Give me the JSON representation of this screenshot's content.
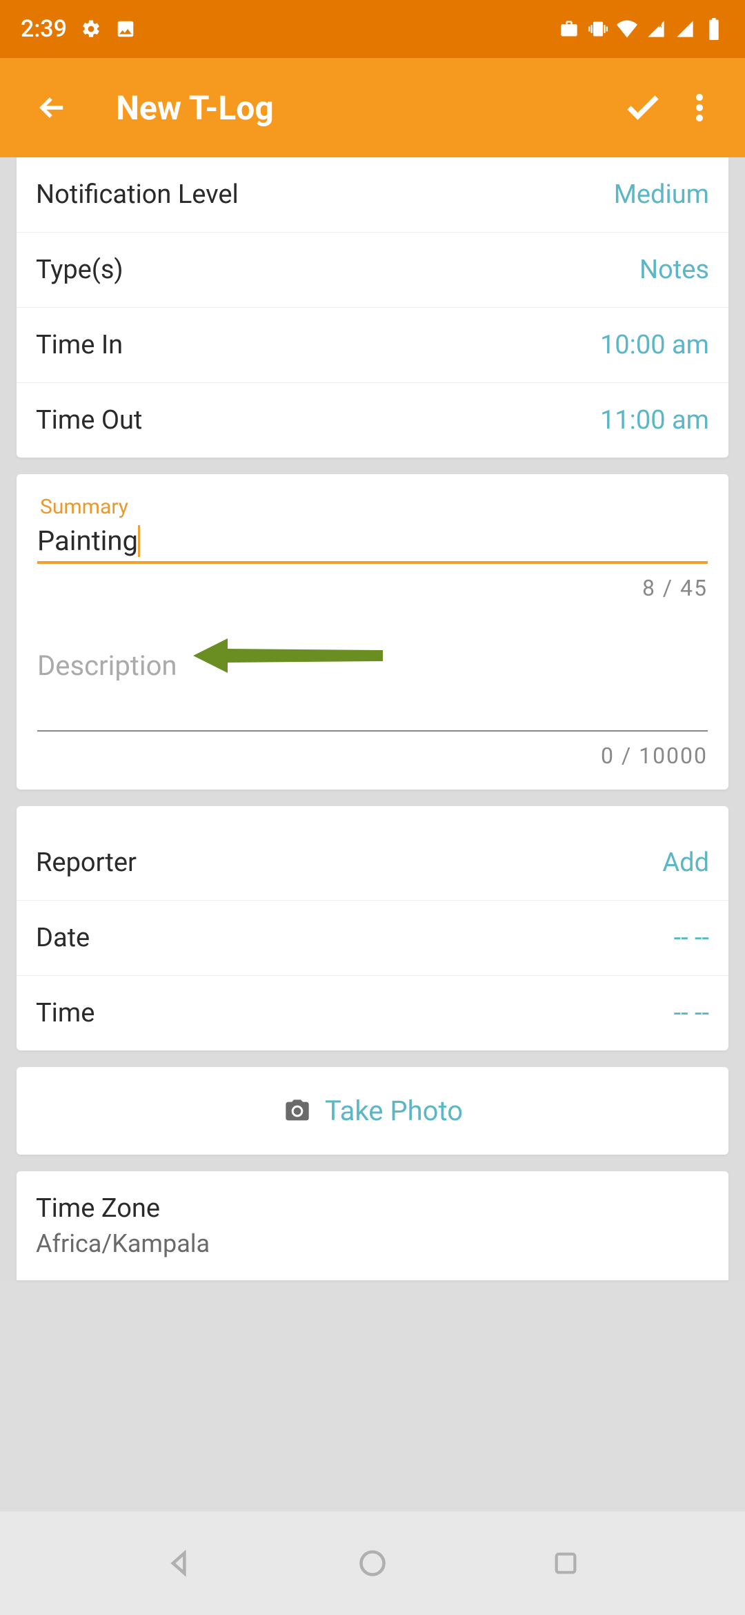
{
  "status": {
    "time": "2:39"
  },
  "appbar": {
    "title": "New T-Log"
  },
  "fields": {
    "notification_level": {
      "label": "Notification Level",
      "value": "Medium"
    },
    "types": {
      "label": "Type(s)",
      "value": "Notes"
    },
    "time_in": {
      "label": "Time In",
      "value": "10:00 am"
    },
    "time_out": {
      "label": "Time Out",
      "value": "11:00 am"
    }
  },
  "summary": {
    "label": "Summary",
    "value": "Painting",
    "counter": "8 / 45"
  },
  "description": {
    "placeholder": "Description",
    "counter": "0 / 10000"
  },
  "reporter": {
    "label": "Reporter",
    "value": "Add"
  },
  "date": {
    "label": "Date",
    "value": "-- --"
  },
  "time": {
    "label": "Time",
    "value": "-- --"
  },
  "photo": {
    "label": "Take Photo"
  },
  "timezone": {
    "label": "Time Zone",
    "value": "Africa/Kampala"
  }
}
